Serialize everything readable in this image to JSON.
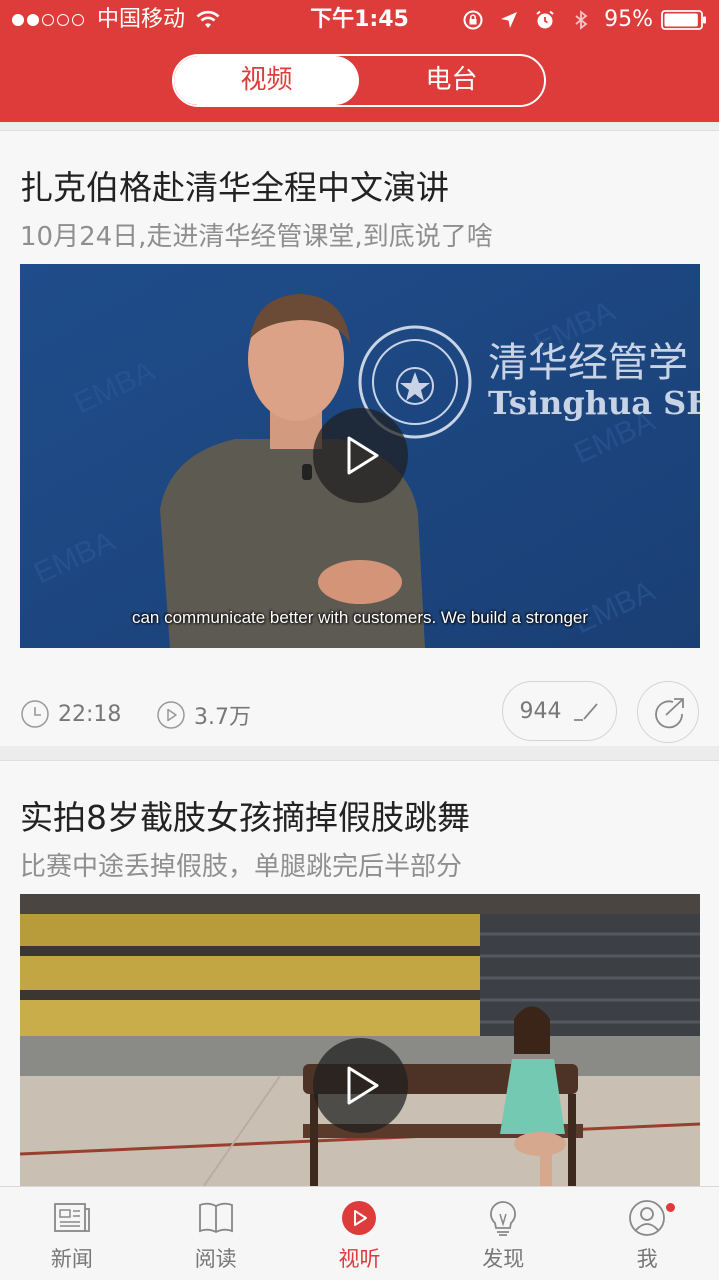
{
  "status_bar": {
    "carrier": "中国移动",
    "time": "下午1:45",
    "battery": "95%",
    "battery_level": 0.95,
    "signal_filled": 2,
    "signal_total": 5
  },
  "segmented": {
    "tabs": [
      {
        "label": "视频",
        "active": true
      },
      {
        "label": "电台",
        "active": false
      }
    ]
  },
  "feed": {
    "items": [
      {
        "title": "扎克伯格赴清华全程中文演讲",
        "subtitle": "10月24日,走进清华经管课堂,到底说了啥",
        "thumbnail_caption": "can communicate better with customers. We build a stronger",
        "thumbnail_logo_text": "清华经管学",
        "thumbnail_logo_en": "Tsinghua SE",
        "duration": "22:18",
        "plays": "3.7万",
        "comments": "944"
      },
      {
        "title": "实拍8岁截肢女孩摘掉假肢跳舞",
        "subtitle": "比赛中途丢掉假肢，单腿跳完后半部分"
      }
    ]
  },
  "tabbar": {
    "tabs": [
      {
        "label": "新闻",
        "icon": "newspaper-icon"
      },
      {
        "label": "阅读",
        "icon": "book-icon"
      },
      {
        "label": "视听",
        "icon": "play-circle-icon",
        "active": true
      },
      {
        "label": "发现",
        "icon": "lightbulb-icon"
      },
      {
        "label": "我",
        "icon": "user-icon",
        "badge": true
      }
    ]
  },
  "colors": {
    "brand_red": "#dd3c3a",
    "text_primary": "#222222",
    "text_secondary": "#8f8f8f"
  }
}
